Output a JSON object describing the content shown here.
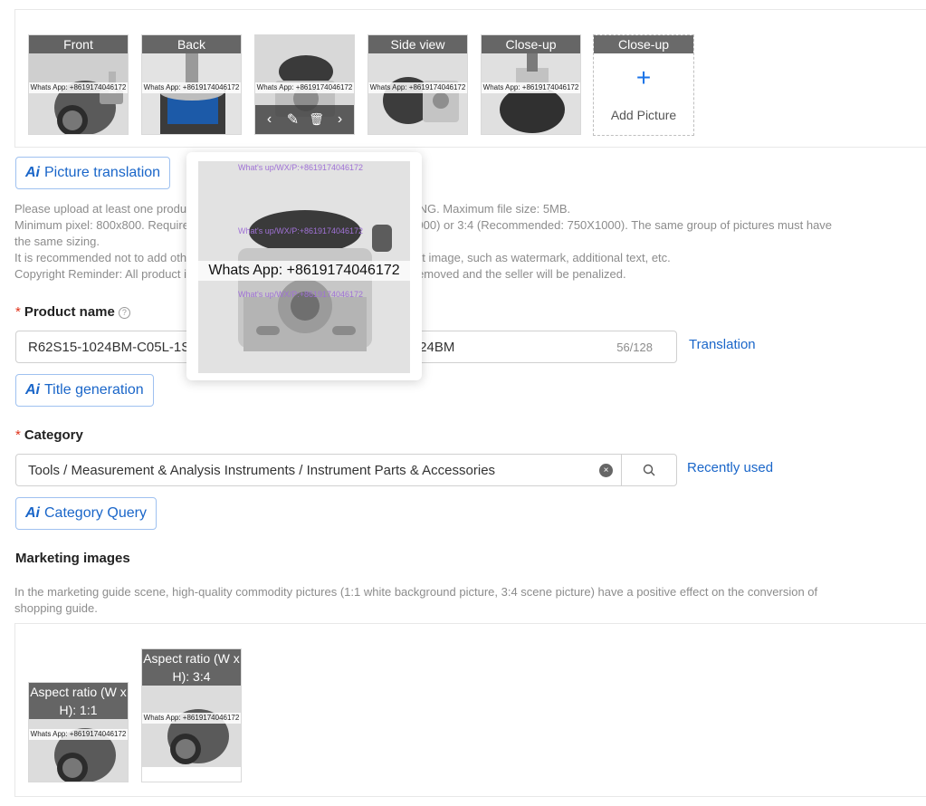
{
  "main_images": {
    "thumbs": [
      {
        "tag": "Front",
        "watermark": "Whats App: +8619174046172"
      },
      {
        "tag": "Back",
        "watermark": "Whats App: +8619174046172"
      },
      {
        "tag": "",
        "watermark": "Whats App: +8619174046172"
      },
      {
        "tag": "Side view",
        "watermark": "Whats App: +8619174046172"
      },
      {
        "tag": "Close-up",
        "watermark": "Whats App: +8619174046172"
      }
    ],
    "add_card": {
      "tag": "Close-up",
      "plus": "+",
      "label": "Add Picture"
    },
    "hover_tools": {
      "prev": "‹",
      "edit": "✎",
      "delete": "🗑",
      "next": "›"
    }
  },
  "preview": {
    "watermark": "Whats App: +8619174046172",
    "faint_top": "What's up/WX/P:+8619174046172",
    "faint_mid": "What's up/WX/P:+8619174046172",
    "faint_low": "What's up/WX/P:+8619174046172"
  },
  "picture_translation": {
    "ai": "Ai",
    "label": "Picture translation"
  },
  "upload_hint": {
    "line1": "Please upload at least one product picture. Supported formats: JPG, JPEG, PNG. Maximum file size: 5MB.",
    "line2": "Minimum pixel: 800x800. Required aspect ratio: 1:1 (Recommended: 1000X1000) or 3:4 (Recommended: 750X1000). The same group of pictures must have",
    "line3": "the same sizing.",
    "line4": "It is recommended not to add other elements that are not related to the product image, such as watermark, additional text, etc.",
    "line5": "Copyright Reminder: All product images must be original, otherwise it will be removed and the seller will be penalized."
  },
  "product_name": {
    "required": "*",
    "label": "Product name",
    "help": "?",
    "value": "R62S15-1024BM-C05L-1SG5-4L Rotary Encoder Incremental 1024BM",
    "counter": "56/128",
    "translation_link": "Translation"
  },
  "title_generation": {
    "ai": "Ai",
    "label": "Title generation"
  },
  "category": {
    "required": "*",
    "label": "Category",
    "value": "Tools / Measurement & Analysis Instruments / Instrument Parts & Accessories",
    "clear": "×",
    "recent_link": "Recently used"
  },
  "category_query": {
    "ai": "Ai",
    "label": "Category Query"
  },
  "marketing": {
    "title": "Marketing images",
    "hint_line1": "In the marketing guide scene, high-quality commodity pictures (1:1 white background picture, 3:4 scene picture) have a positive effect on the conversion of",
    "hint_line2": "shopping guide.",
    "card1_tag": "Aspect ratio (W x H): 1:1",
    "card2_tag": "Aspect ratio (W x H): 3:4",
    "watermark": "Whats App: +8619174046172"
  },
  "colors": {
    "accent": "#1a66c9",
    "required": "#e0321a",
    "hint": "#8c8c8c"
  }
}
